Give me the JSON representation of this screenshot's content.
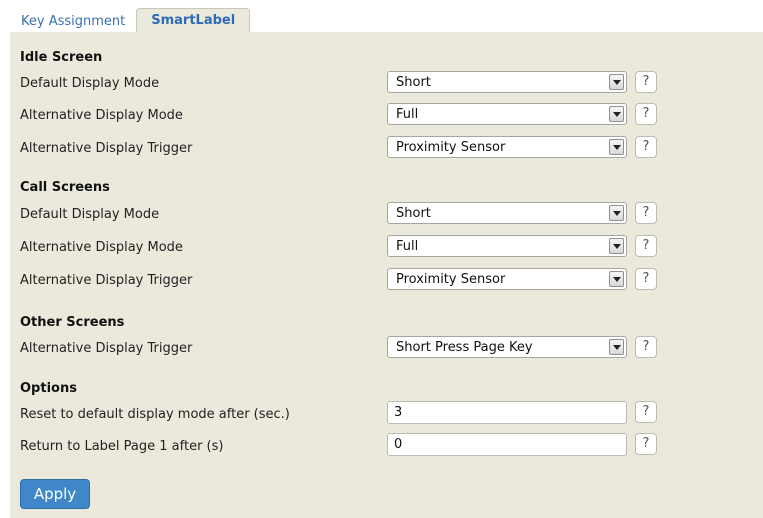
{
  "tabs": {
    "key_assignment": "Key Assignment",
    "smartlabel": "SmartLabel"
  },
  "help_symbol": "?",
  "sections": {
    "idle": {
      "title": "Idle Screen",
      "default_mode_label": "Default Display Mode",
      "default_mode_value": "Short",
      "alt_mode_label": "Alternative Display Mode",
      "alt_mode_value": "Full",
      "alt_trigger_label": "Alternative Display Trigger",
      "alt_trigger_value": "Proximity Sensor"
    },
    "call": {
      "title": "Call Screens",
      "default_mode_label": "Default Display Mode",
      "default_mode_value": "Short",
      "alt_mode_label": "Alternative Display Mode",
      "alt_mode_value": "Full",
      "alt_trigger_label": "Alternative Display Trigger",
      "alt_trigger_value": "Proximity Sensor"
    },
    "other": {
      "title": "Other Screens",
      "alt_trigger_label": "Alternative Display Trigger",
      "alt_trigger_value": "Short Press Page Key"
    },
    "options": {
      "title": "Options",
      "reset_label": "Reset to default display mode after (sec.)",
      "reset_value": "3",
      "return_label": "Return to Label Page 1 after (s)",
      "return_value": "0"
    }
  },
  "apply_label": "Apply",
  "colors": {
    "panel_bg": "#ebe9dc",
    "tab_text": "#3a6fb0",
    "apply_bg": "#3f87c8"
  }
}
